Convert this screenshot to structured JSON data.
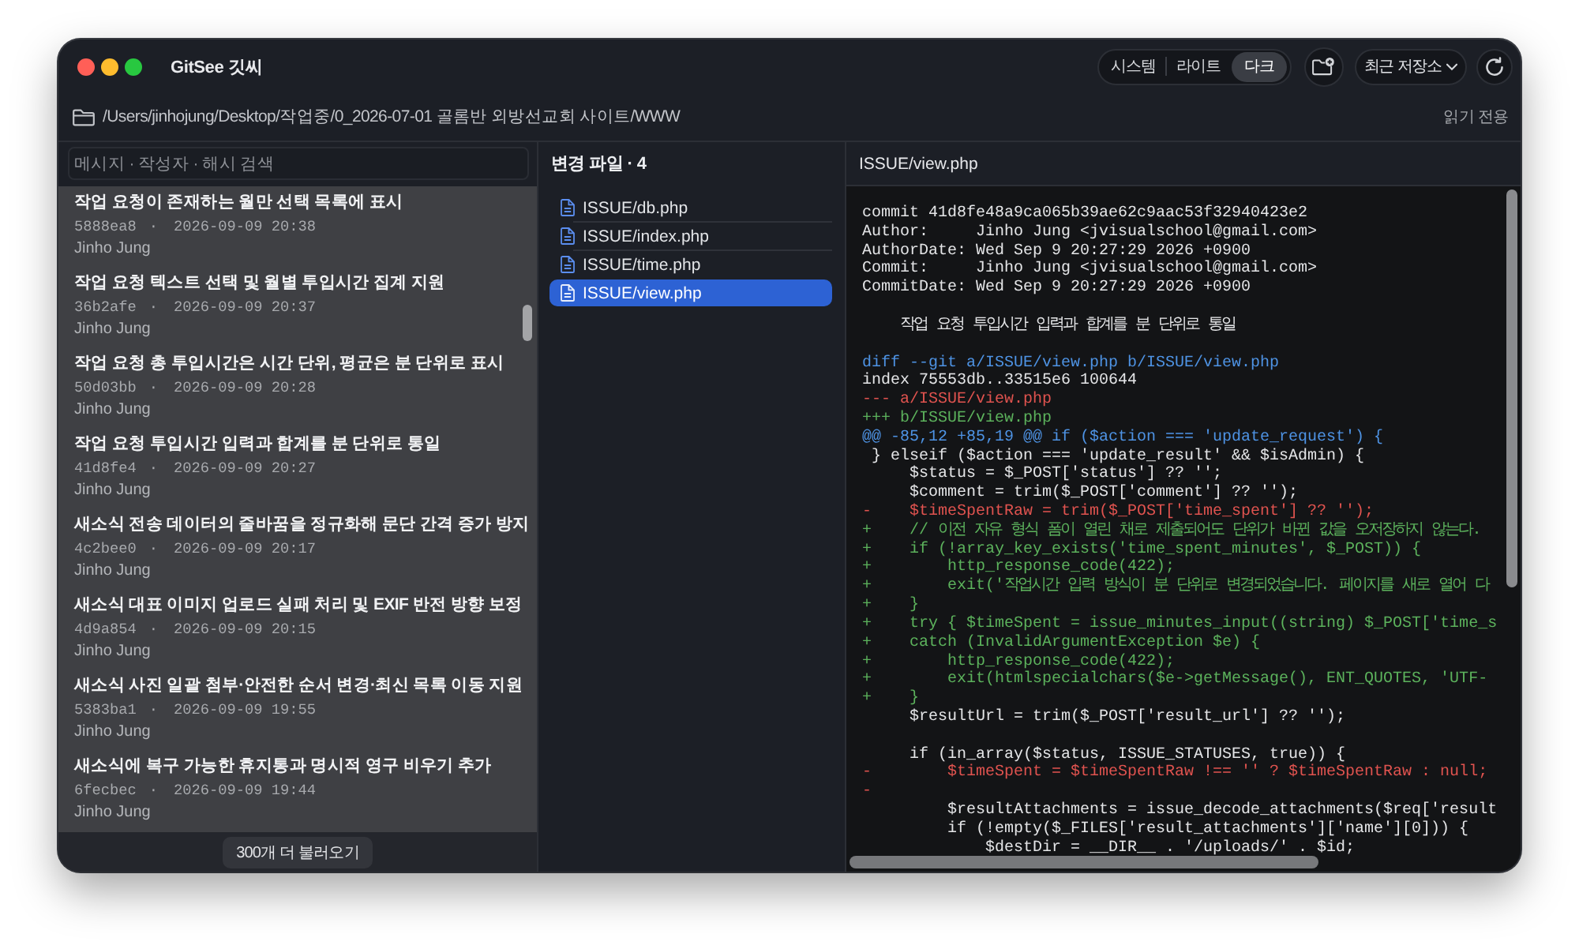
{
  "window": {
    "title": "GitSee 깃씨"
  },
  "toolbar": {
    "theme_options": [
      {
        "label": "시스템",
        "selected": false
      },
      {
        "label": "라이트",
        "selected": false
      },
      {
        "label": "다크",
        "selected": true
      }
    ],
    "recent_repos": "최근 저장소"
  },
  "path_bar": {
    "path": "/Users/jinhojung/Desktop/작업중/0_2026-07-01 골롬반 외방선교회 사이트/WWW",
    "mode": "읽기 전용"
  },
  "commit_list": {
    "search": {
      "placeholder": "메시지 · 작성자 · 해시 검색"
    },
    "commits": [
      {
        "title": "작업 요청이 존재하는 월만 선택 목록에 표시",
        "hash": "5888ea8",
        "separator": "·",
        "date": "2026-09-09 20:38",
        "author": "Jinho Jung"
      },
      {
        "title": "작업 요청 텍스트 선택 및 월별 투입시간 집계 지원",
        "hash": "36b2afe",
        "separator": "·",
        "date": "2026-09-09 20:37",
        "author": "Jinho Jung"
      },
      {
        "title": "작업 요청 총 투입시간은 시간 단위, 평균은 분 단위로 표시",
        "hash": "50d03bb",
        "separator": "·",
        "date": "2026-09-09 20:28",
        "author": "Jinho Jung"
      },
      {
        "title": "작업 요청 투입시간 입력과 합계를 분 단위로 통일",
        "hash": "41d8fe4",
        "separator": "·",
        "date": "2026-09-09 20:27",
        "author": "Jinho Jung"
      },
      {
        "title": "새소식 전송 데이터의 줄바꿈을 정규화해 문단 간격 증가 방지",
        "hash": "4c2bee0",
        "separator": "·",
        "date": "2026-09-09 20:17",
        "author": "Jinho Jung"
      },
      {
        "title": "새소식 대표 이미지 업로드 실패 처리 및 EXIF 반전 방향 보정",
        "hash": "4d9a854",
        "separator": "·",
        "date": "2026-09-09 20:15",
        "author": "Jinho Jung"
      },
      {
        "title": "새소식 사진 일괄 첨부·안전한 순서 변경·최신 목록 이동 지원",
        "hash": "5383ba1",
        "separator": "·",
        "date": "2026-09-09 19:55",
        "author": "Jinho Jung"
      },
      {
        "title": "새소식에 복구 가능한 휴지통과 명시적 영구 비우기 추가",
        "hash": "6fecbec",
        "separator": "·",
        "date": "2026-09-09 19:44",
        "author": "Jinho Jung"
      }
    ],
    "load_more": "300개 더 불러오기"
  },
  "changed_files": {
    "title": "변경 파일 · 4",
    "files": [
      {
        "name": "ISSUE/db.php",
        "selected": false
      },
      {
        "name": "ISSUE/index.php",
        "selected": false
      },
      {
        "name": "ISSUE/time.php",
        "selected": false
      },
      {
        "name": "ISSUE/view.php",
        "selected": true
      }
    ]
  },
  "diff_view": {
    "file": "ISSUE/view.php",
    "lines": [
      {
        "kind": "plain",
        "text": "commit 41d8fe48a9ca065b39ae62c9aac53f32940423e2"
      },
      {
        "kind": "plain",
        "text": "Author:     Jinho Jung <jvisualschool@gmail.com>"
      },
      {
        "kind": "plain",
        "text": "AuthorDate: Wed Sep 9 20:27:29 2026 +0900"
      },
      {
        "kind": "plain",
        "text": "Commit:     Jinho Jung <jvisualschool@gmail.com>"
      },
      {
        "kind": "plain",
        "text": "CommitDate: Wed Sep 9 20:27:29 2026 +0900"
      },
      {
        "kind": "blank"
      },
      {
        "kind": "plain",
        "text": "    작업 요청 투입시간 입력과 합계를 분 단위로 통일"
      },
      {
        "kind": "blank"
      },
      {
        "kind": "header",
        "text": "diff --git a/ISSUE/view.php b/ISSUE/view.php"
      },
      {
        "kind": "plain",
        "text": "index 75553db..33515e6 100644"
      },
      {
        "kind": "removed",
        "text": "--- a/ISSUE/view.php"
      },
      {
        "kind": "added",
        "text": "+++ b/ISSUE/view.php"
      },
      {
        "kind": "header",
        "text": "@@ -85,12 +85,19 @@ if ($action === 'update_request') {"
      },
      {
        "kind": "plain",
        "text": " } elseif ($action === 'update_result' && $isAdmin) {"
      },
      {
        "kind": "plain",
        "text": "     $status = $_POST['status'] ?? '';"
      },
      {
        "kind": "plain",
        "text": "     $comment = trim($_POST['comment'] ?? '');"
      },
      {
        "kind": "removed",
        "text": "-    $timeSpentRaw = trim($_POST['time_spent'] ?? '');"
      },
      {
        "kind": "added",
        "text": "+    // 이전 자유 형식 폼이 열린 채로 제출되어도 단위가 바뀐 값을 오저장하지 않는다."
      },
      {
        "kind": "added",
        "text": "+    if (!array_key_exists('time_spent_minutes', $_POST)) {"
      },
      {
        "kind": "added",
        "text": "+        http_response_code(422);"
      },
      {
        "kind": "added",
        "text": "+        exit('작업시간 입력 방식이 분 단위로 변경되었습니다. 페이지를 새로 열어 다"
      },
      {
        "kind": "added",
        "text": "+    }"
      },
      {
        "kind": "added",
        "text": "+    try { $timeSpent = issue_minutes_input((string) $_POST['time_s"
      },
      {
        "kind": "added",
        "text": "+    catch (InvalidArgumentException $e) {"
      },
      {
        "kind": "added",
        "text": "+        http_response_code(422);"
      },
      {
        "kind": "added",
        "text": "+        exit(htmlspecialchars($e->getMessage(), ENT_QUOTES, 'UTF-"
      },
      {
        "kind": "added",
        "text": "+    }"
      },
      {
        "kind": "plain",
        "text": "     $resultUrl = trim($_POST['result_url'] ?? '');"
      },
      {
        "kind": "blank"
      },
      {
        "kind": "plain",
        "text": "     if (in_array($status, ISSUE_STATUSES, true)) {"
      },
      {
        "kind": "removed",
        "text": "-        $timeSpent = $timeSpentRaw !== '' ? $timeSpentRaw : null;"
      },
      {
        "kind": "removed",
        "text": "-"
      },
      {
        "kind": "plain",
        "text": "         $resultAttachments = issue_decode_attachments($req['result"
      },
      {
        "kind": "plain",
        "text": "         if (!empty($_FILES['result_attachments']['name'][0])) {"
      },
      {
        "kind": "plain",
        "text": "             $destDir = __DIR__ . '/uploads/' . $id;"
      }
    ]
  }
}
